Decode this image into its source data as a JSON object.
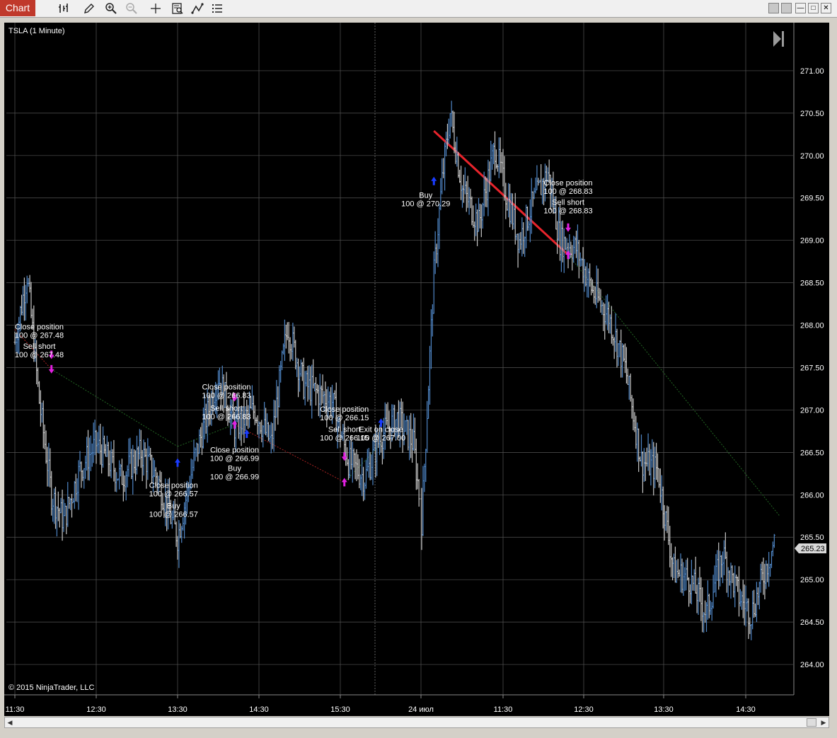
{
  "window": {
    "tab_label": "Chart",
    "toolbar_icons": [
      "bar-style-icon",
      "draw-icon",
      "zoom-in-icon",
      "zoom-out-icon",
      "crosshair-icon",
      "data-box-icon",
      "drawing-tools-icon",
      "properties-icon"
    ],
    "window_controls": [
      "tile-button",
      "restore-button",
      "minimize-button",
      "maximize-button",
      "close-button"
    ]
  },
  "chart": {
    "instrument_label": "TSLA (1 Minute)",
    "copyright": "© 2015 NinjaTrader, LLC",
    "last_price_label": "265.23",
    "colors": {
      "up_bar": "#4f86c6",
      "down_bar": "#c8c8c8",
      "trade_line": "#e8242c",
      "marker_sell": "#e020e0",
      "marker_buy": "#1a3cff",
      "grid": "#555555"
    }
  },
  "chart_data": {
    "type": "candlestick",
    "x_ticks": [
      "11:30",
      "12:30",
      "13:30",
      "14:30",
      "15:30",
      "24 июл",
      "11:30",
      "12:30",
      "13:30",
      "14:30"
    ],
    "y_ticks": [
      "264.00",
      "264.50",
      "265.00",
      "265.50",
      "266.00",
      "266.50",
      "267.00",
      "267.50",
      "268.00",
      "268.50",
      "269.00",
      "269.50",
      "270.00",
      "270.50",
      "271.00"
    ],
    "ylim": [
      263.65,
      271.55
    ],
    "last_price": 265.23,
    "session_break_index": 5,
    "price_path": [
      [
        0,
        267.8
      ],
      [
        0.15,
        268.6
      ],
      [
        0.3,
        267.1
      ],
      [
        0.45,
        266.0
      ],
      [
        0.6,
        265.7
      ],
      [
        0.8,
        266.3
      ],
      [
        1.0,
        266.6
      ],
      [
        1.3,
        266.2
      ],
      [
        1.55,
        266.5
      ],
      [
        1.75,
        266.2
      ],
      [
        2.0,
        265.5
      ],
      [
        2.2,
        266.4
      ],
      [
        2.5,
        267.4
      ],
      [
        2.7,
        266.8
      ],
      [
        2.95,
        267.0
      ],
      [
        3.15,
        266.6
      ],
      [
        3.35,
        268.0
      ],
      [
        3.55,
        267.3
      ],
      [
        3.9,
        267.1
      ],
      [
        4.1,
        266.4
      ],
      [
        4.3,
        266.2
      ],
      [
        4.5,
        266.7
      ],
      [
        4.7,
        266.9
      ],
      [
        4.9,
        266.6
      ],
      [
        5.0,
        265.7
      ],
      [
        5.15,
        268.6
      ],
      [
        5.25,
        269.7
      ],
      [
        5.35,
        270.5
      ],
      [
        5.5,
        269.6
      ],
      [
        5.7,
        269.2
      ],
      [
        5.9,
        270.1
      ],
      [
        6.05,
        269.5
      ],
      [
        6.2,
        269.0
      ],
      [
        6.35,
        269.4
      ],
      [
        6.55,
        269.8
      ],
      [
        6.7,
        269.0
      ],
      [
        6.9,
        268.9
      ],
      [
        7.1,
        268.4
      ],
      [
        7.3,
        268.1
      ],
      [
        7.5,
        267.5
      ],
      [
        7.7,
        266.4
      ],
      [
        7.9,
        266.3
      ],
      [
        8.1,
        265.1
      ],
      [
        8.3,
        265.0
      ],
      [
        8.5,
        264.6
      ],
      [
        8.7,
        265.3
      ],
      [
        8.9,
        264.8
      ],
      [
        9.05,
        264.6
      ],
      [
        9.25,
        265.2
      ],
      [
        9.35,
        265.5
      ]
    ],
    "trade_lines": [
      {
        "from": [
          0.0,
          267.95
        ],
        "to": [
          0.45,
          267.48
        ],
        "style": "dotted",
        "color": "#aa2222"
      },
      {
        "from": [
          0.45,
          267.48
        ],
        "to": [
          2.0,
          266.57
        ],
        "style": "dotted",
        "color": "#226622"
      },
      {
        "from": [
          2.0,
          266.57
        ],
        "to": [
          2.7,
          266.83
        ],
        "style": "dotted",
        "color": "#226622"
      },
      {
        "from": [
          2.7,
          266.83
        ],
        "to": [
          4.05,
          266.15
        ],
        "style": "dotted",
        "color": "#aa2222"
      },
      {
        "from": [
          4.05,
          266.15
        ],
        "to": [
          4.5,
          266.6
        ],
        "style": "dotted",
        "color": "#226622"
      },
      {
        "from": [
          5.15,
          270.29
        ],
        "to": [
          6.8,
          268.83
        ],
        "style": "solid",
        "color": "#e8242c"
      },
      {
        "from": [
          6.8,
          268.83
        ],
        "to": [
          9.4,
          265.75
        ],
        "style": "dotted",
        "color": "#226622"
      }
    ],
    "annotations": [
      {
        "line1": "Close position",
        "line2": "100 @ 267.48",
        "x": 0.3,
        "price": 267.95,
        "offset": 0
      },
      {
        "line1": "Sell short",
        "line2": "100 @ 267.48",
        "x": 0.3,
        "price": 267.72,
        "offset": 0
      },
      {
        "line1": "Close position",
        "line2": "100 @ 266.57",
        "x": 1.95,
        "price": 266.08,
        "offset": 0
      },
      {
        "line1": "Buy",
        "line2": "100 @ 266.57",
        "x": 1.95,
        "price": 265.84,
        "offset": 0
      },
      {
        "line1": "Close position",
        "line2": "100 @ 266.83",
        "x": 2.6,
        "price": 267.24,
        "offset": 0
      },
      {
        "line1": "Sell short",
        "line2": "100 @ 266.83",
        "x": 2.6,
        "price": 266.99,
        "offset": 0
      },
      {
        "line1": "Close position",
        "line2": "100 @ 266.99",
        "x": 2.7,
        "price": 266.5,
        "offset": 0
      },
      {
        "line1": "Buy",
        "line2": "100 @ 266.99",
        "x": 2.7,
        "price": 266.28,
        "offset": 0
      },
      {
        "line1": "Close position",
        "line2": "100 @ 266.15",
        "x": 4.05,
        "price": 266.98,
        "offset": 0
      },
      {
        "line1": "Sell short",
        "line2": "100 @ 266.15",
        "x": 4.05,
        "price": 266.74,
        "offset": 0
      },
      {
        "line1": "Exit on close",
        "line2": "100 @ 267.00",
        "x": 4.5,
        "price": 266.74,
        "offset": 0
      },
      {
        "line1": "Buy",
        "line2": "100 @ 270.29",
        "x": 5.05,
        "price": 269.5,
        "offset": 0
      },
      {
        "line1": "Close position",
        "line2": "100 @ 268.83",
        "x": 6.8,
        "price": 269.65,
        "offset": 0
      },
      {
        "line1": "Sell short",
        "line2": "100 @ 268.83",
        "x": 6.8,
        "price": 269.42,
        "offset": 0
      }
    ],
    "markers": [
      {
        "x": 0.45,
        "price": 267.65,
        "dir": "down",
        "color": "#e020e0"
      },
      {
        "x": 0.45,
        "price": 267.48,
        "dir": "down",
        "color": "#e020e0"
      },
      {
        "x": 2.0,
        "price": 266.38,
        "dir": "up",
        "color": "#1a3cff"
      },
      {
        "x": 2.7,
        "price": 267.15,
        "dir": "down",
        "color": "#e020e0"
      },
      {
        "x": 2.7,
        "price": 266.83,
        "dir": "up",
        "color": "#e020e0"
      },
      {
        "x": 2.85,
        "price": 266.72,
        "dir": "up",
        "color": "#1a3cff"
      },
      {
        "x": 4.05,
        "price": 266.45,
        "dir": "down",
        "color": "#e020e0"
      },
      {
        "x": 4.05,
        "price": 266.15,
        "dir": "up",
        "color": "#e020e0"
      },
      {
        "x": 4.5,
        "price": 266.85,
        "dir": "up",
        "color": "#1a3cff"
      },
      {
        "x": 5.15,
        "price": 269.7,
        "dir": "up",
        "color": "#1a3cff"
      },
      {
        "x": 6.8,
        "price": 269.15,
        "dir": "down",
        "color": "#e020e0"
      },
      {
        "x": 6.8,
        "price": 268.83,
        "dir": "up",
        "color": "#e020e0"
      }
    ]
  }
}
